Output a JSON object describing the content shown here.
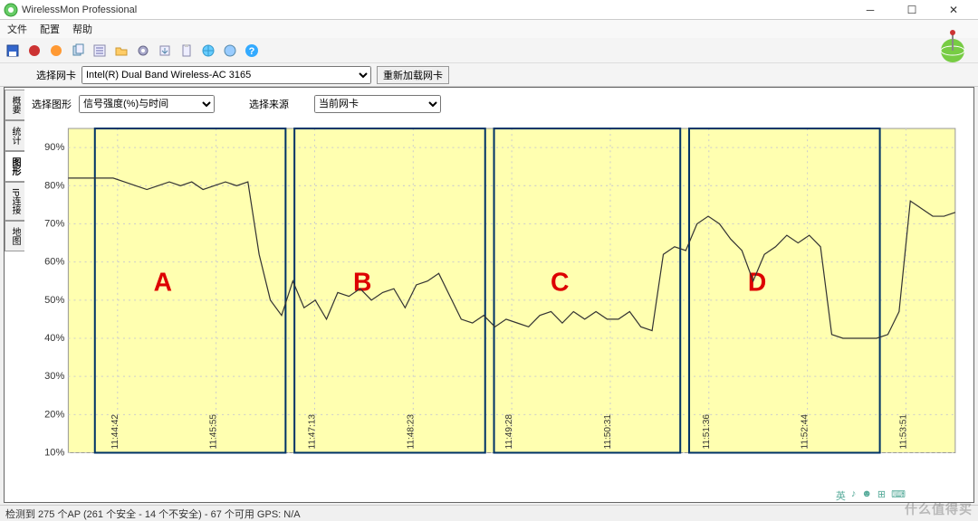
{
  "window": {
    "title": "WirelessMon Professional"
  },
  "menu": {
    "file": "文件",
    "config": "配置",
    "help": "帮助"
  },
  "selector": {
    "nic_label": "选择网卡",
    "nic_value": "Intel(R) Dual Band Wireless-AC 3165",
    "reload": "重新加载网卡"
  },
  "tabs": {
    "summary": "概要",
    "stats": "统计",
    "graph": "图形",
    "ipconn": "IP连接",
    "map": "地图"
  },
  "graphctl": {
    "type_label": "选择图形",
    "type_value": "信号强度(%)与时间",
    "src_label": "选择来源",
    "src_value": "当前网卡"
  },
  "status": "检测到 275 个AP (261 个安全 - 14 个不安全) - 67 个可用 GPS: N/A",
  "watermark": "什么值得买",
  "ime_text": "英",
  "chart_data": {
    "type": "line",
    "ylabel": "Signal Strength %",
    "xlabel": "Time",
    "ylim": [
      10,
      95
    ],
    "y_ticks": [
      10,
      20,
      30,
      40,
      50,
      60,
      70,
      80,
      90
    ],
    "x_tick_labels": [
      "11:44:42",
      "11:45:55",
      "11:47:13",
      "11:48:23",
      "11:49:28",
      "11:50:31",
      "11:51:36",
      "11:52:44",
      "11:53:51"
    ],
    "regions": [
      {
        "name": "A",
        "x0": 0.03,
        "x1": 0.245
      },
      {
        "name": "B",
        "x0": 0.255,
        "x1": 0.47
      },
      {
        "name": "C",
        "x0": 0.48,
        "x1": 0.69
      },
      {
        "name": "D",
        "x0": 0.7,
        "x1": 0.915
      }
    ],
    "values": [
      82,
      82,
      82,
      82,
      82,
      81,
      80,
      79,
      80,
      81,
      80,
      81,
      79,
      80,
      81,
      80,
      81,
      62,
      50,
      46,
      55,
      48,
      50,
      45,
      52,
      51,
      53,
      50,
      52,
      53,
      48,
      54,
      55,
      57,
      51,
      45,
      44,
      46,
      43,
      45,
      44,
      43,
      46,
      47,
      44,
      47,
      45,
      47,
      45,
      45,
      47,
      43,
      42,
      62,
      64,
      63,
      70,
      72,
      70,
      66,
      63,
      55,
      62,
      64,
      67,
      65,
      67,
      64,
      41,
      40,
      40,
      40,
      40,
      41,
      47,
      76,
      74,
      72,
      72,
      73
    ]
  }
}
